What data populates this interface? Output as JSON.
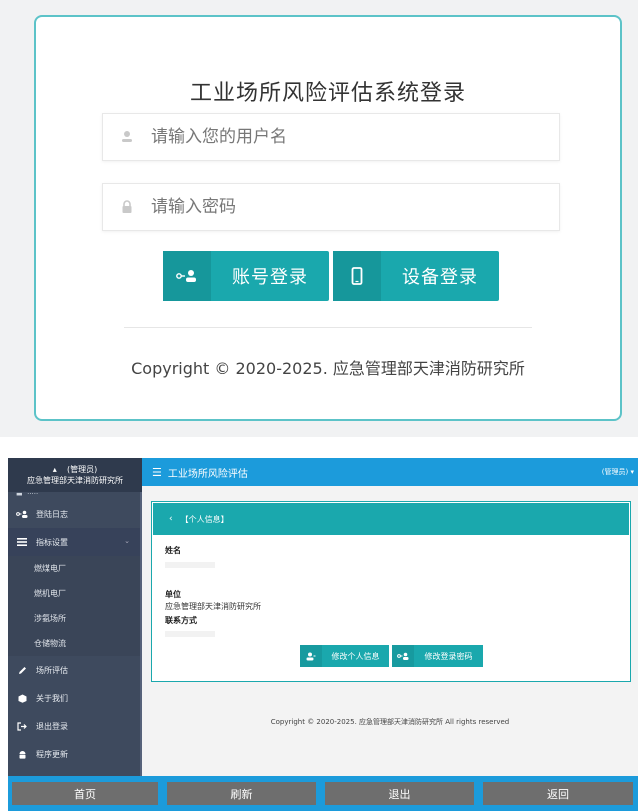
{
  "login": {
    "title": "工业场所风险评估系统登录",
    "username_placeholder": "请输入您的用户名",
    "password_placeholder": "请输入密码",
    "account_login_label": "账号登录",
    "device_login_label": "设备登录",
    "copyright": "Copyright © 2020-2025. 应急管理部天津消防研究所"
  },
  "admin": {
    "sidebar": {
      "role": "(管理员)",
      "org": "应急管理部天津消防研究所",
      "items": [
        {
          "label": "登陆日志"
        },
        {
          "label": "指标设置"
        },
        {
          "label": "场所评估"
        },
        {
          "label": "关于我们"
        },
        {
          "label": "退出登录"
        },
        {
          "label": "程序更新"
        }
      ],
      "sub_items": [
        {
          "label": "燃煤电厂"
        },
        {
          "label": "燃机电厂"
        },
        {
          "label": "涉氨场所"
        },
        {
          "label": "仓储物流"
        }
      ]
    },
    "topbar": {
      "title": "工业场所风险评估",
      "user": "(管理员) ▾"
    },
    "panel": {
      "header": "【个人信息】",
      "name_label": "姓名",
      "unit_label": "单位",
      "unit_value": "应急管理部天津消防研究所",
      "contact_label": "联系方式",
      "edit_info_label": "修改个人信息",
      "edit_password_label": "修改登录密码"
    },
    "copyright": "Copyright © 2020-2025. 应急管理部天津消防研究所 All rights reserved",
    "bottom_bar": {
      "home": "首页",
      "refresh": "刷新",
      "exit": "退出",
      "back": "返回"
    }
  }
}
